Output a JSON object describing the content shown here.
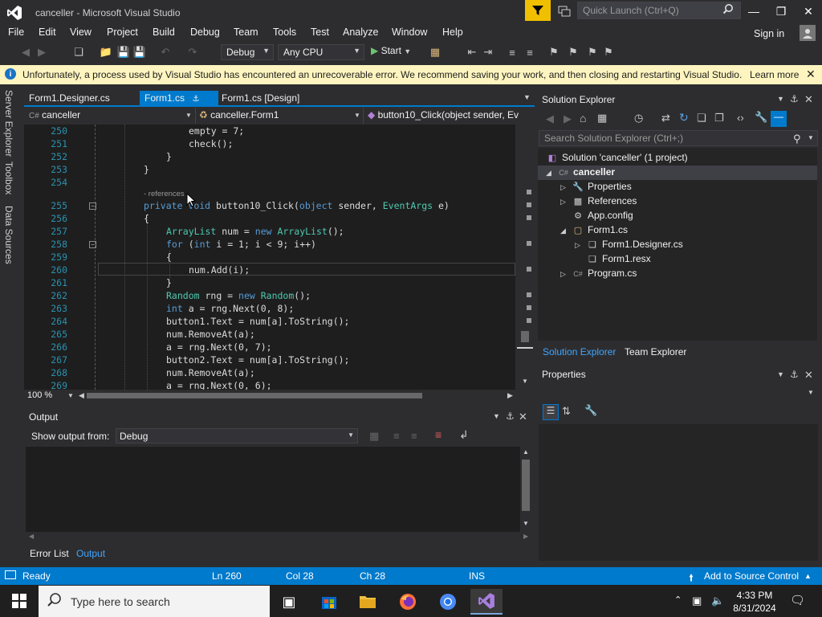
{
  "window": {
    "title": "canceller - Microsoft Visual Studio",
    "quick_launch_placeholder": "Quick Launch (Ctrl+Q)",
    "minimize": "—",
    "restore": "❐",
    "close": "✕"
  },
  "menu": [
    "File",
    "Edit",
    "View",
    "Project",
    "Build",
    "Debug",
    "Team",
    "Tools",
    "Test",
    "Analyze",
    "Window",
    "Help"
  ],
  "account": {
    "sign_in": "Sign in"
  },
  "toolbar": {
    "config": "Debug",
    "platform": "Any CPU",
    "start": "Start"
  },
  "infobar": {
    "message": "Unfortunately, a process used by Visual Studio has encountered an unrecoverable error.  We recommend saving your work, and then closing and restarting Visual Studio.",
    "link": "Learn more"
  },
  "side_tabs": [
    "Server Explorer",
    "Toolbox",
    "Data Sources"
  ],
  "editor": {
    "tabs": [
      {
        "label": "Form1.Designer.cs",
        "active": false
      },
      {
        "label": "Form1.cs",
        "active": true
      },
      {
        "label": "Form1.cs [Design]",
        "active": false
      }
    ],
    "nav": {
      "project": "canceller",
      "class": "canceller.Form1",
      "member": "button10_Click(object sender, Ev"
    },
    "references_hint": "- references",
    "lines": [
      {
        "n": "250",
        "text": "empty = 7;"
      },
      {
        "n": "251",
        "text": "check();"
      },
      {
        "n": "252",
        "text": "}"
      },
      {
        "n": "253",
        "text": "}"
      },
      {
        "n": "254",
        "text": ""
      },
      {
        "n": "255",
        "text": "private void button10_Click(object sender, EventArgs e)"
      },
      {
        "n": "256",
        "text": "{"
      },
      {
        "n": "257",
        "text": "ArrayList num = new ArrayList();"
      },
      {
        "n": "258",
        "text": "for (int i = 1; i < 9; i++)"
      },
      {
        "n": "259",
        "text": "{"
      },
      {
        "n": "260",
        "text": "num.Add(i);"
      },
      {
        "n": "261",
        "text": "}"
      },
      {
        "n": "262",
        "text": "Random rng = new Random();"
      },
      {
        "n": "263",
        "text": "int a = rng.Next(0, 8);"
      },
      {
        "n": "264",
        "text": "button1.Text = num[a].ToString();"
      },
      {
        "n": "265",
        "text": "num.RemoveAt(a);"
      },
      {
        "n": "266",
        "text": "a = rng.Next(0, 7);"
      },
      {
        "n": "267",
        "text": "button2.Text = num[a].ToString();"
      },
      {
        "n": "268",
        "text": "num.RemoveAt(a);"
      },
      {
        "n": "269",
        "text": "a = rng.Next(0, 6);"
      }
    ],
    "zoom": "100 %"
  },
  "output": {
    "title": "Output",
    "show_from_label": "Show output from:",
    "source": "Debug",
    "tabs": [
      "Error List",
      "Output"
    ]
  },
  "solution_explorer": {
    "title": "Solution Explorer",
    "search_placeholder": "Search Solution Explorer (Ctrl+;)",
    "tree": [
      {
        "label": "Solution 'canceller' (1 project)"
      },
      {
        "label": "canceller"
      },
      {
        "label": "Properties"
      },
      {
        "label": "References"
      },
      {
        "label": "App.config"
      },
      {
        "label": "Form1.cs"
      },
      {
        "label": "Form1.Designer.cs"
      },
      {
        "label": "Form1.resx"
      },
      {
        "label": "Program.cs"
      }
    ],
    "tabs": [
      "Solution Explorer",
      "Team Explorer"
    ]
  },
  "properties": {
    "title": "Properties"
  },
  "statusbar": {
    "status": "Ready",
    "line": "Ln 260",
    "col": "Col 28",
    "ch": "Ch 28",
    "mode": "INS",
    "source_control": "Add to Source Control"
  },
  "taskbar": {
    "search_placeholder": "Type here to search",
    "time": "4:33 PM",
    "date": "8/31/2024"
  },
  "colors": {
    "accent": "#007acc",
    "infobar": "#fdf4bf",
    "editor_bg": "#1e1e1e",
    "chrome_bg": "#2d2d30"
  }
}
